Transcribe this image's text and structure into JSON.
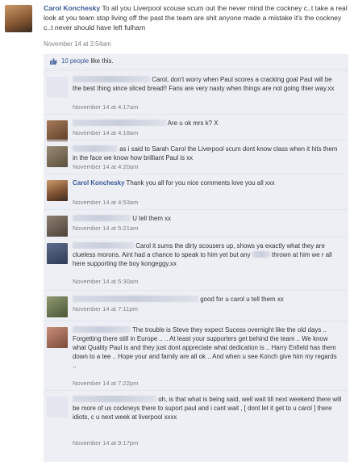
{
  "post": {
    "author": "Carol Konchesky",
    "text": "To all you Liverpool scouse scum out the never mind the cockney c..t take a real look at you team stop living off the past the team are shit anyone made a mistake it's the cockney c..t never should have left fulham",
    "time": "November 14 at 3:54am"
  },
  "feedback": {
    "likes_link": "10 people",
    "likes_suffix": "like this.",
    "like_icon": "thumbs-up-icon"
  },
  "comments": [
    {
      "text": "Carol, don't worry when Paul scores a cracking goal Paul will be the best thing since sliced bread!! Fans are very nasty when things are not going thier way.xx",
      "time": "November 14 at 4:17am"
    },
    {
      "text": "Are u ok mrs k? X",
      "time": "November 14 at 4:18am"
    },
    {
      "text": "as i said to Sarah Carol the Liverpool scum dont know class when it hits them in the face we know how brilliant Paul is xx",
      "time": "November 14 at 4:20am"
    },
    {
      "author": "Carol Konchesky",
      "text": "Thank you all for you nice comments love you all xxx",
      "time": "November 14 at 4:53am"
    },
    {
      "text": "U tell them xx",
      "time": "November 14 at 5:21am"
    },
    {
      "text_a": "Carol it sums the dirty scousers up, shows ya exactly what they are clueless morons. Aint had a chance to speak to him yet but any",
      "text_b": "thrown at him we r all here supporting the boy kongeggy.xx",
      "time": "November 14 at 5:30am"
    },
    {
      "text": "good for u carol u tell them xx",
      "time": "November 14 at 7:11pm"
    },
    {
      "text": "The trouble is Steve they expect Sucess overnight like the old days .. Forgetting there still in Europe .. .. At least your supporters get behind the team .. We know what Quality Paul is and they just dont appreciate what dedication is .. Harry Enfield has them down to a tee .. Hope your and family are all ok .. And when u see Konch give him my regards ..",
      "time": "November 14 at 7:22pm"
    },
    {
      "text": "oh, is that what is being said, well wait till next weekend there will be more of us cockneys there to suport paul and i cant wait , [ dont let it get to u carol ] there idiots, c u next week at liverpool xxxx",
      "time": "November 14 at 9:17pm"
    }
  ],
  "colors": {
    "link": "#3b5998",
    "feedback_bg": "#edeff4",
    "timestamp": "#808080"
  }
}
